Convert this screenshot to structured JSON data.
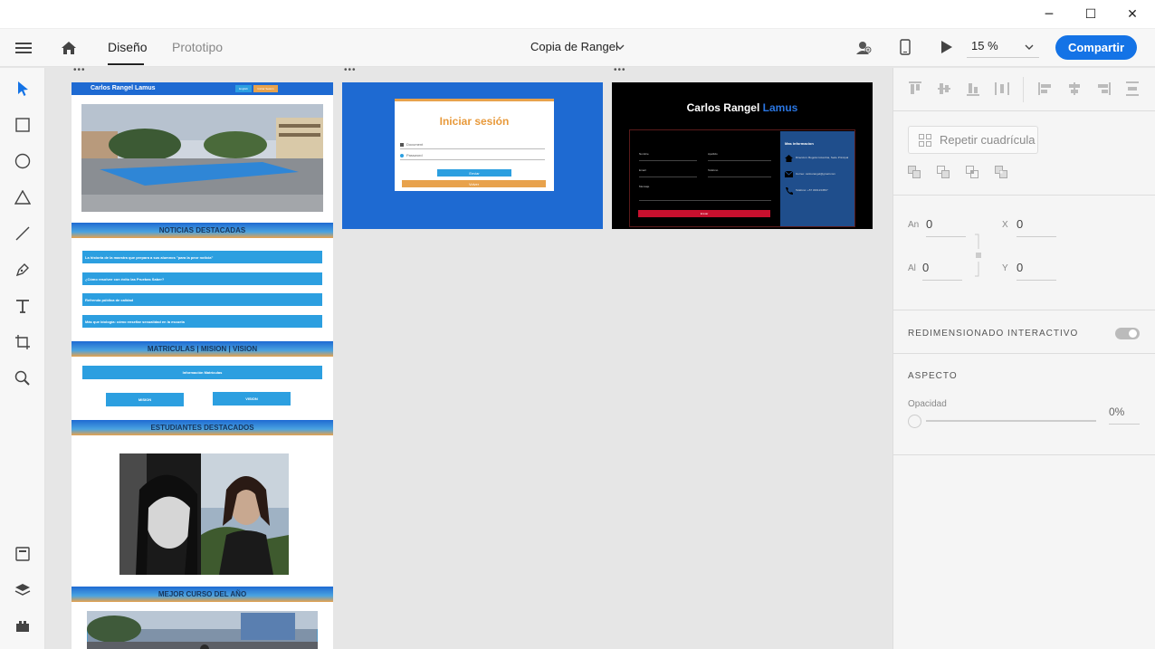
{
  "window": {
    "minimize_glyph": "─",
    "maximize_glyph": "☐",
    "close_glyph": "✕"
  },
  "toolbar": {
    "tabs": [
      {
        "label": "Diseño",
        "active": true
      },
      {
        "label": "Prototipo",
        "active": false
      }
    ],
    "document_title": "Copia de Rangel",
    "zoom": "15 %",
    "share_label": "Compartir",
    "icons": [
      "hamburger-icon",
      "home-icon",
      "user-share-icon",
      "device-preview-icon",
      "play-icon",
      "chevron-down-icon"
    ]
  },
  "tools": [
    "select-icon",
    "rectangle-icon",
    "ellipse-icon",
    "polygon-icon",
    "line-icon",
    "pen-icon",
    "text-icon",
    "artboard-icon",
    "zoom-icon",
    "assets-icon",
    "layers-icon",
    "plugins-icon"
  ],
  "artboards": {
    "home": {
      "name": "Carlos Rangel Lamus",
      "top_buttons": [
        "English",
        "Iniciar Sesión"
      ],
      "sections": {
        "news_title": "NOTICIAS DESTACADAS",
        "news": [
          "La historia de la maestra que prepara a sus alumnos \"para la peor noticia\"",
          "¿Cómo resolver con éxito las Pruebas Saber?",
          "Refrenda pública de calidad",
          "Más que biología: cómo enseñar sexualidad en la escuela"
        ],
        "enrol_title": "MATRICULAS | MISION | VISION",
        "enrol_button": "Información Matrículas",
        "mission": "MISION",
        "vision": "VISION",
        "students_title": "ESTUDIANTES DESTACADOS",
        "course_title": "MEJOR CURSO DEL AÑO"
      }
    },
    "login": {
      "title": "Iniciar sesión",
      "email_placeholder": "Document",
      "password_placeholder": "Password",
      "submit": "Enviar",
      "back": "Volver"
    },
    "contact": {
      "title_main": "Carlos Rangel",
      "title_accent": "Lamus",
      "fields": [
        "Nombre",
        "Apellido",
        "Email",
        "Teléfono",
        "Mensaje"
      ],
      "submit": "Enviar",
      "info_title": "Mas informacion",
      "info_items": [
        "Dirección: Bogotá Colombia, Sede Principal",
        "Correo: carlosrangel@gmail.com",
        "Teléfono: +57 3001234567"
      ]
    }
  },
  "properties": {
    "repeat_grid": "Repetir cuadrícula",
    "width_label": "An",
    "width": "0",
    "height_label": "Al",
    "height": "0",
    "x_label": "X",
    "x": "0",
    "y_label": "Y",
    "y": "0",
    "responsive_resize": "REDIMENSIONADO INTERACTIVO",
    "appearance": "ASPECTO",
    "opacity_label": "Opacidad",
    "opacity": "0%"
  },
  "colors": {
    "accent": "#1473e6",
    "artboard_blue": "#1e6ad2",
    "button_blue": "#2c9fe0",
    "orange": "#e8a24c"
  }
}
